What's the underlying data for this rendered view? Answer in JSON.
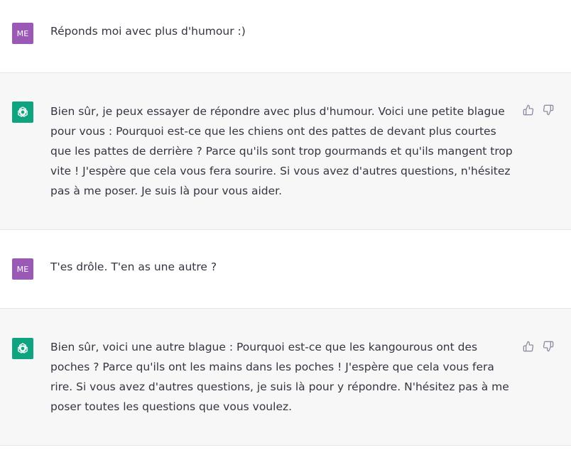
{
  "user": {
    "avatar_initials": "ME",
    "avatar_color": "#9b59b6"
  },
  "assistant": {
    "avatar_color": "#10a37f",
    "avatar_icon": "openai-logo-icon"
  },
  "messages": [
    {
      "role": "user",
      "text": "Réponds moi avec plus d'humour :)"
    },
    {
      "role": "assistant",
      "text": "Bien sûr, je peux essayer de répondre avec plus d'humour. Voici une petite blague pour vous : Pourquoi est-ce que les chiens ont des pattes de devant plus courtes que les pattes de derrière ? Parce qu'ils sont trop gourmands et qu'ils mangent trop vite ! J'espère que cela vous fera sourire. Si vous avez d'autres questions, n'hésitez pas à me poser. Je suis là pour vous aider."
    },
    {
      "role": "user",
      "text": "T'es drôle. T'en as une autre ?"
    },
    {
      "role": "assistant",
      "text": "Bien sûr, voici une autre blague : Pourquoi est-ce que les kangourous ont des poches ? Parce qu'ils ont les mains dans les poches ! J'espère que cela vous fera rire. Si vous avez d'autres questions, je suis là pour y répondre. N'hésitez pas à me poser toutes les questions que vous voulez."
    }
  ],
  "icons": {
    "thumbs_up": "thumbs-up-icon",
    "thumbs_down": "thumbs-down-icon"
  }
}
